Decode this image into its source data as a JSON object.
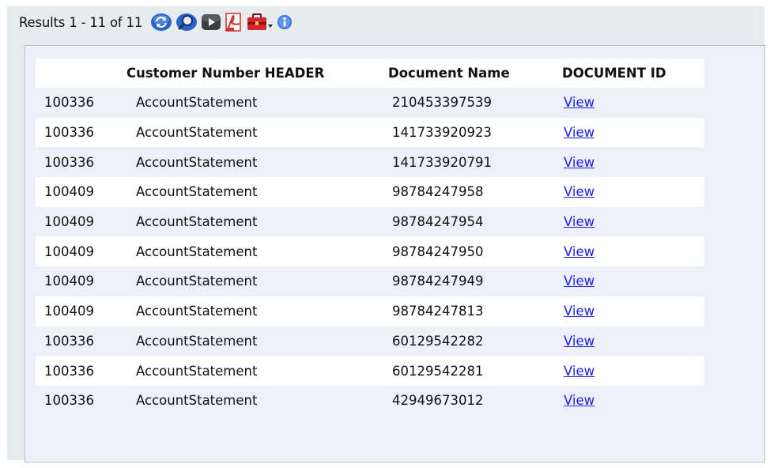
{
  "toolbar": {
    "results_label": "Results 1 - 11 of 11",
    "icons": [
      "refresh-icon",
      "search-icon",
      "play-icon",
      "pdf-icon",
      "toolbox-icon",
      "info-icon"
    ]
  },
  "table": {
    "headers": [
      "",
      "Customer Number HEADER",
      "Document Name",
      "DOCUMENT ID"
    ],
    "rows": [
      {
        "customer": "100336",
        "document_name": "AccountStatement",
        "document_id": "210453397539",
        "link": "View"
      },
      {
        "customer": "100336",
        "document_name": "AccountStatement",
        "document_id": "141733920923",
        "link": "View"
      },
      {
        "customer": "100336",
        "document_name": "AccountStatement",
        "document_id": "141733920791",
        "link": "View"
      },
      {
        "customer": "100409",
        "document_name": "AccountStatement",
        "document_id": "98784247958",
        "link": "View"
      },
      {
        "customer": "100409",
        "document_name": "AccountStatement",
        "document_id": "98784247954",
        "link": "View"
      },
      {
        "customer": "100409",
        "document_name": "AccountStatement",
        "document_id": "98784247950",
        "link": "View"
      },
      {
        "customer": "100409",
        "document_name": "AccountStatement",
        "document_id": "98784247949",
        "link": "View"
      },
      {
        "customer": "100409",
        "document_name": "AccountStatement",
        "document_id": "98784247813",
        "link": "View"
      },
      {
        "customer": "100336",
        "document_name": "AccountStatement",
        "document_id": "60129542282",
        "link": "View"
      },
      {
        "customer": "100336",
        "document_name": "AccountStatement",
        "document_id": "60129542281",
        "link": "View"
      },
      {
        "customer": "100336",
        "document_name": "AccountStatement",
        "document_id": "42949673012",
        "link": "View"
      }
    ]
  },
  "colors": {
    "frame_bg": "#e6eced",
    "panel_bg": "#eef0f9",
    "row_alt_bg": "#ffffff",
    "link": "#1f22e6"
  }
}
